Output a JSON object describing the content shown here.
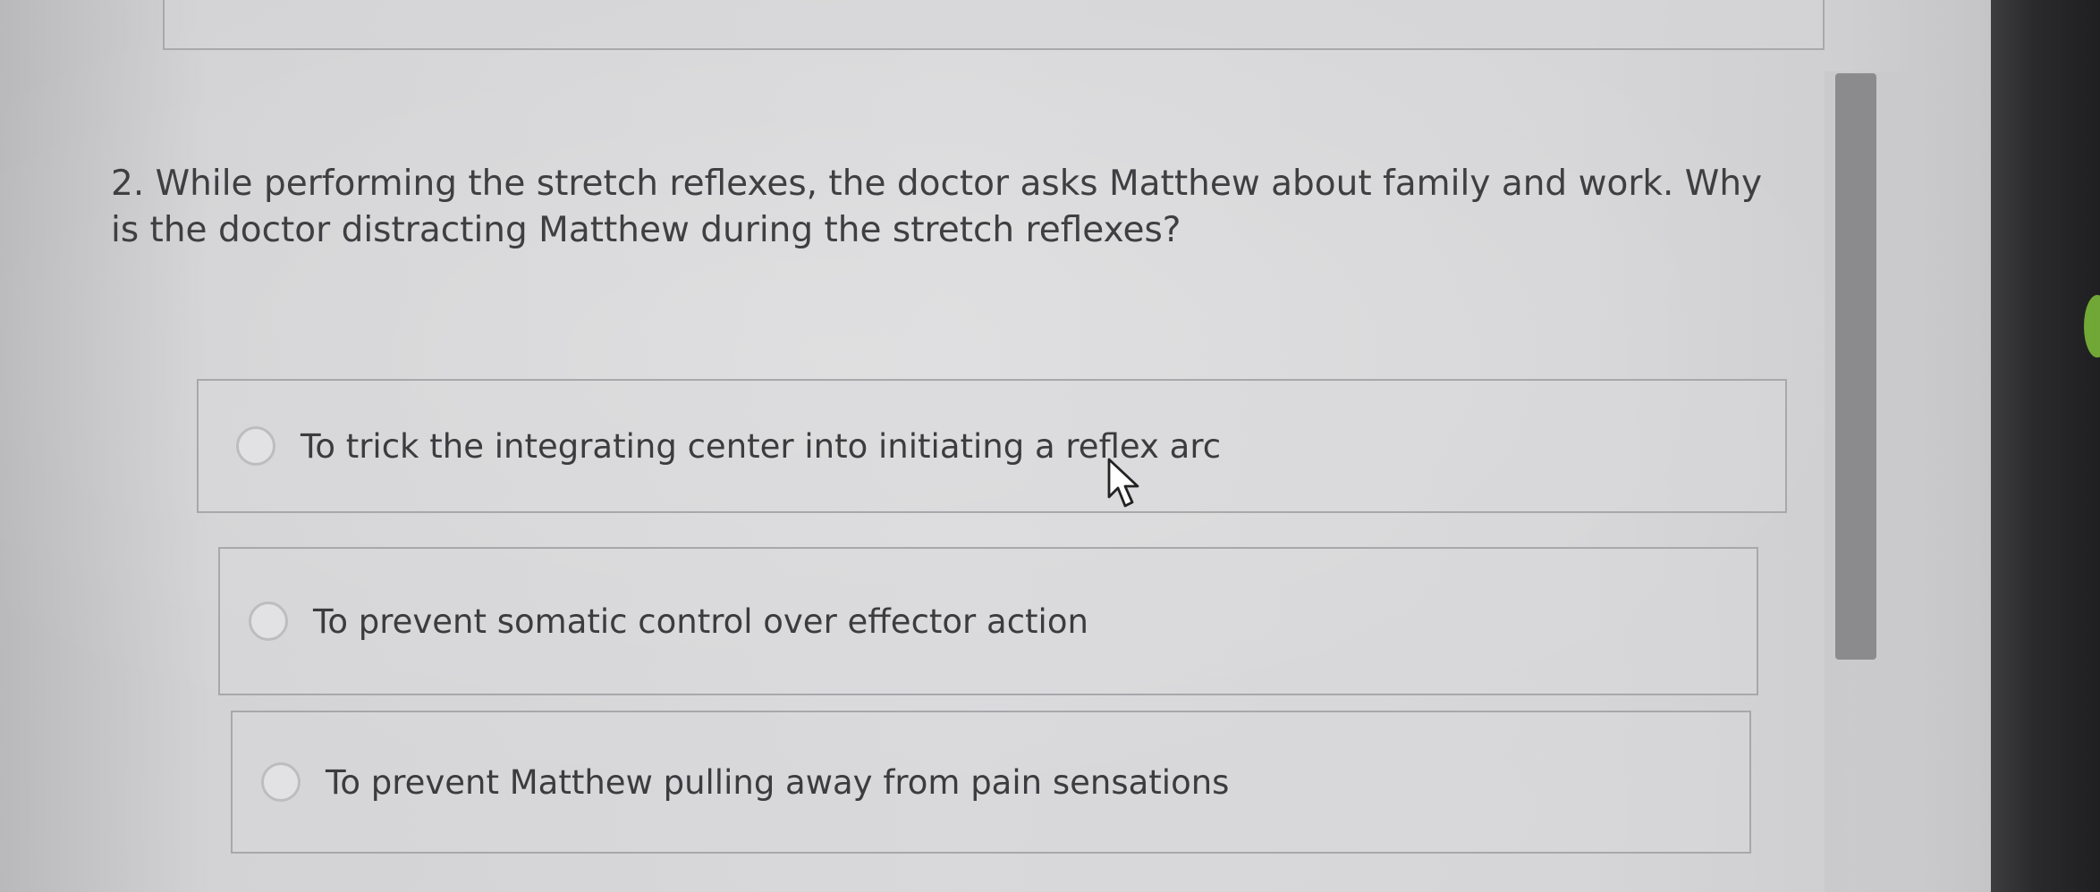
{
  "question": {
    "text": "2. While performing the stretch reflexes, the doctor asks Matthew about family and work. Why is the doctor distracting Matthew during the stretch reflexes?"
  },
  "options": [
    {
      "label": "To trick the integrating center into initiating a reflex arc",
      "selected": false
    },
    {
      "label": "To prevent somatic control over effector action",
      "selected": false
    },
    {
      "label": "To prevent Matthew pulling away from pain sensations",
      "selected": false
    }
  ],
  "icons": {
    "cursor": "mouse-pointer-icon",
    "radio": "radio-unchecked-icon"
  },
  "colors": {
    "text": "#3f3f42",
    "border": "#a8a8ab",
    "scrollbar_thumb": "#8b8b8e",
    "indicator": "#7fbf3a"
  }
}
